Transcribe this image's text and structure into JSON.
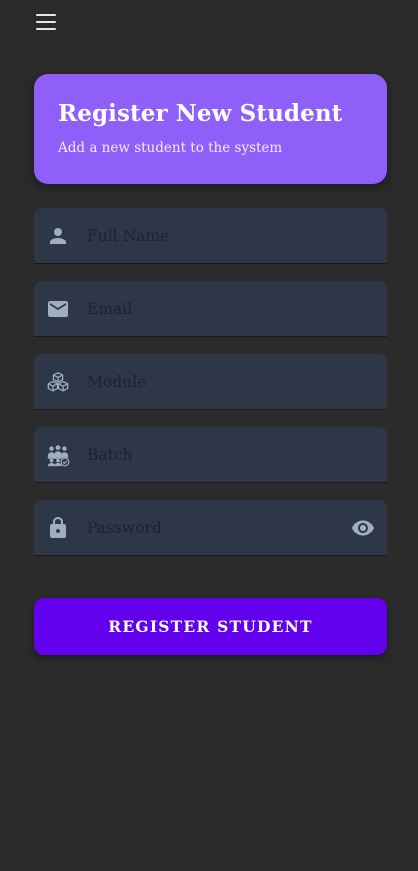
{
  "appbar": {
    "menu_icon": "hamburger-menu-icon"
  },
  "header": {
    "title": "Register New Student",
    "subtitle": "Add a new student to the system",
    "color": "#8f5ff9"
  },
  "form": {
    "fields": [
      {
        "icon": "person-icon",
        "placeholder": "Full Name"
      },
      {
        "icon": "email-icon",
        "placeholder": "Email"
      },
      {
        "icon": "cubes-icon",
        "placeholder": "Module"
      },
      {
        "icon": "group-icon",
        "placeholder": "Batch"
      },
      {
        "icon": "lock-icon",
        "placeholder": "Password",
        "trailing_icon": "eye-icon"
      }
    ],
    "field_color": "#2d3748",
    "icon_color": "#a0aec0"
  },
  "submit": {
    "label": "REGISTER STUDENT",
    "color": "#6200ee"
  }
}
